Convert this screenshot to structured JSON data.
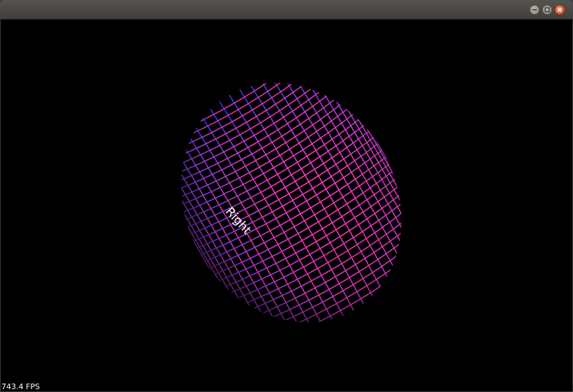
{
  "window": {
    "controls": {
      "minimize_icon": "minimize-icon",
      "maximize_icon": "maximize-icon",
      "close_icon": "close-icon"
    }
  },
  "scene": {
    "object": "wireframe-capsule",
    "face_label": "Right",
    "colors": {
      "background": "#000000",
      "blue": "#3a52ff",
      "magenta": "#e040e8",
      "pink": "#ff3aa0",
      "label": "#ffffff"
    }
  },
  "status": {
    "fps_text": "743.4 FPS"
  }
}
